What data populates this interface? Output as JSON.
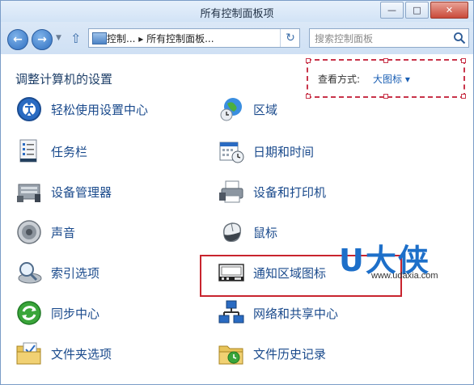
{
  "window": {
    "title": "所有控制面板项",
    "minimize_icon": "minimize-icon",
    "maximize_icon": "maximize-icon",
    "close_icon": "close-icon"
  },
  "address": {
    "path": "控制... ▸ 所有控制面板...",
    "search_placeholder": "搜索控制面板"
  },
  "header": {
    "title": "调整计算机的设置",
    "view_label": "查看方式:",
    "view_value": "大图标 ▾"
  },
  "items": [
    {
      "label": "轻松使用设置中心",
      "icon": "ease-of-access-icon"
    },
    {
      "label": "区域",
      "icon": "region-globe-icon"
    },
    {
      "label": "任务栏",
      "icon": "taskbar-icon"
    },
    {
      "label": "日期和时间",
      "icon": "date-time-icon"
    },
    {
      "label": "设备管理器",
      "icon": "device-manager-icon"
    },
    {
      "label": "设备和打印机",
      "icon": "printer-icon"
    },
    {
      "label": "声音",
      "icon": "speaker-icon"
    },
    {
      "label": "鼠标",
      "icon": "mouse-icon"
    },
    {
      "label": "索引选项",
      "icon": "indexing-icon"
    },
    {
      "label": "通知区域图标",
      "icon": "notification-area-icon"
    },
    {
      "label": "同步中心",
      "icon": "sync-center-icon"
    },
    {
      "label": "网络和共享中心",
      "icon": "network-icon"
    },
    {
      "label": "文件夹选项",
      "icon": "folder-options-icon"
    },
    {
      "label": "文件历史记录",
      "icon": "file-history-icon"
    }
  ],
  "watermark": {
    "brand": "U大侠",
    "url": "www.udaxia.com"
  },
  "colors": {
    "link": "#1a4a8c",
    "highlight": "#c8242e",
    "brand": "#1d6fc9"
  }
}
